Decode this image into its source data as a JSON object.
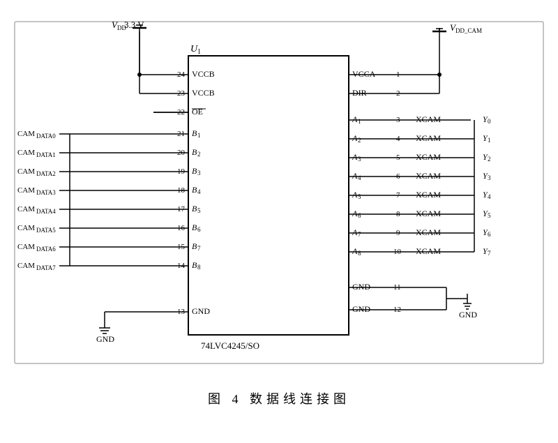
{
  "diagram": {
    "title": "U₁",
    "ic_name": "74LVC4245/SO",
    "caption": "图 4   数据线连接图",
    "vdd_label": "V_DD 3.3 V",
    "vdd_cam_label": "V_DD_CAM",
    "gnd_label": "GND",
    "left_pins": [
      {
        "num": "24",
        "name": "VCCB"
      },
      {
        "num": "23",
        "name": "VCCB"
      },
      {
        "num": "22",
        "name": "OE_bar"
      },
      {
        "num": "21",
        "name": "B₁"
      },
      {
        "num": "20",
        "name": "B₂"
      },
      {
        "num": "19",
        "name": "B₃"
      },
      {
        "num": "18",
        "name": "B₄"
      },
      {
        "num": "17",
        "name": "B₅"
      },
      {
        "num": "16",
        "name": "B₆"
      },
      {
        "num": "15",
        "name": "B₇"
      },
      {
        "num": "14",
        "name": "B₈"
      },
      {
        "num": "13",
        "name": "GND"
      }
    ],
    "right_pins": [
      {
        "num": "1",
        "name": "VCCA"
      },
      {
        "num": "2",
        "name": "DIR"
      },
      {
        "num": "3",
        "name": "A₁",
        "xcam": "XCAM",
        "y": "Y₀"
      },
      {
        "num": "4",
        "name": "A₂",
        "xcam": "XCAM",
        "y": "Y₁"
      },
      {
        "num": "5",
        "name": "A₃",
        "xcam": "XCAM",
        "y": "Y₂"
      },
      {
        "num": "6",
        "name": "A₄",
        "xcam": "XCAM",
        "y": "Y₃"
      },
      {
        "num": "7",
        "name": "A₅",
        "xcam": "XCAM",
        "y": "Y₄"
      },
      {
        "num": "8",
        "name": "A₆",
        "xcam": "XCAM",
        "y": "Y₅"
      },
      {
        "num": "9",
        "name": "A₇",
        "xcam": "XCAM",
        "y": "Y₆"
      },
      {
        "num": "10",
        "name": "A₈",
        "xcam": "XCAM",
        "y": "Y₇"
      },
      {
        "num": "11",
        "name": "GND"
      },
      {
        "num": "12",
        "name": "GND"
      }
    ],
    "cam_signals": [
      "CAM_DATA0",
      "CAM_DATA1",
      "CAM_DATA2",
      "CAM_DATA3",
      "CAM_DATA4",
      "CAM_DATA5",
      "CAM_DATA6",
      "CAM_DATA7"
    ]
  }
}
